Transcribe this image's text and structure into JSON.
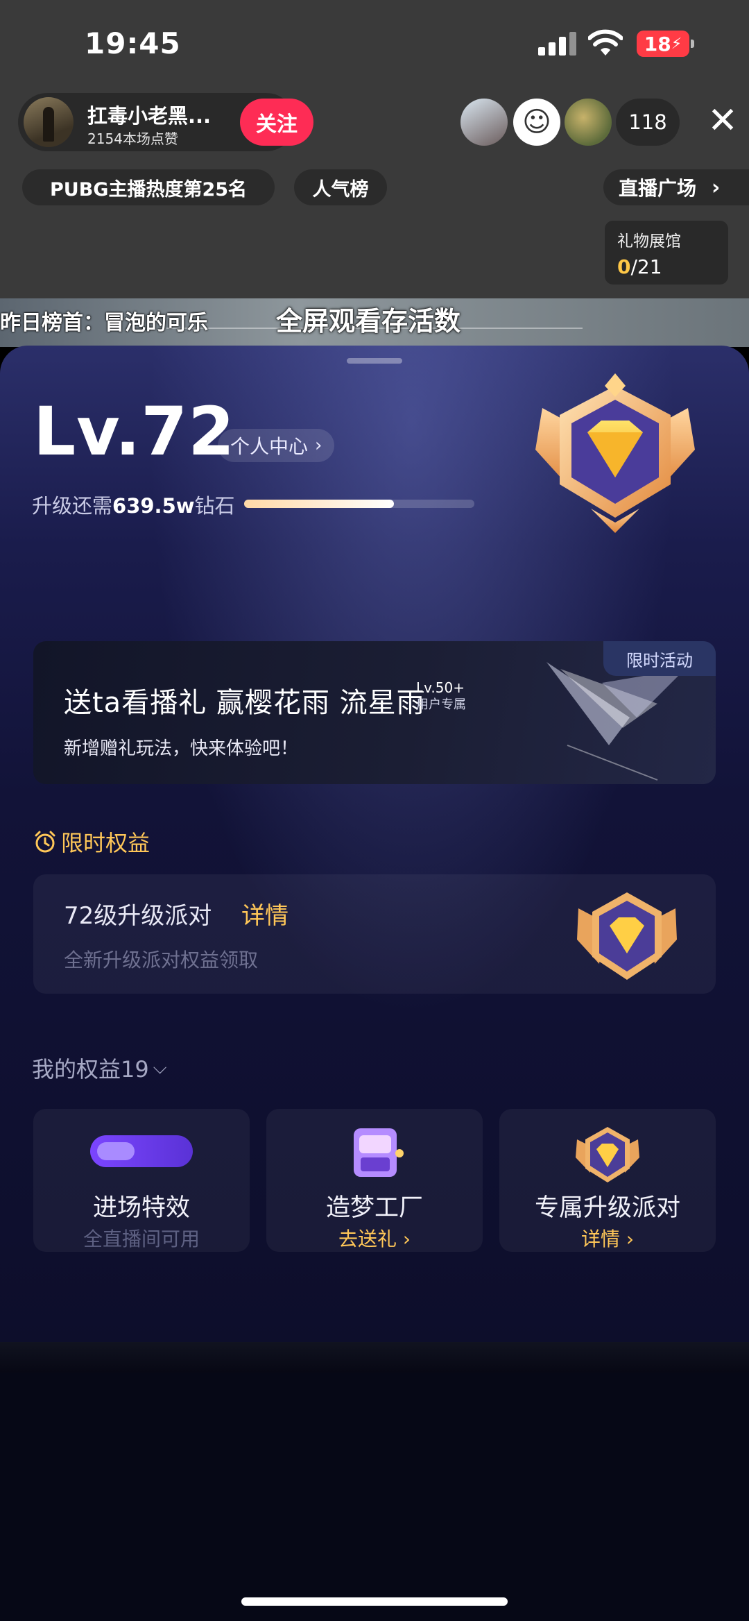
{
  "status_bar": {
    "time": "19:45",
    "battery": "18"
  },
  "anchor": {
    "name": "扛毒小老黑...",
    "likes": "2154本场点赞",
    "follow_label": "关注"
  },
  "viewers": {
    "count": "118"
  },
  "tags": {
    "rank": "PUBG主播热度第25名",
    "popular": "人气榜",
    "plaza": "直播广场"
  },
  "gift_hall": {
    "label": "礼物展馆",
    "current": "0",
    "total": "/21"
  },
  "video_overlay": {
    "yesterday_top": "昨日榜首：冒泡的可乐",
    "fullscreen_hint": "全屏观看存活数"
  },
  "level_panel": {
    "level": "Lv.72",
    "personal_center": "个人中心",
    "upgrade_prefix": "升级还需",
    "upgrade_amount": "639.5w",
    "upgrade_suffix": "钻石",
    "progress": 0.65
  },
  "banner": {
    "tag": "限时活动",
    "title": "送ta看播礼  赢樱花雨 流星雨",
    "lv_requirement": "Lv.50+",
    "lv_note": "用户专属",
    "subtitle": "新增赠礼玩法，快来体验吧！"
  },
  "limited_rights": {
    "title": "限时权益",
    "party_title": "72级升级派对",
    "party_detail": "详情",
    "party_desc": "全新升级派对权益领取"
  },
  "my_rights": {
    "label": "我的权益19",
    "items": [
      {
        "title": "进场特效",
        "sub": "全直播间可用"
      },
      {
        "title": "造梦工厂",
        "sub": "去送礼"
      },
      {
        "title": "专属升级派对",
        "sub": "详情"
      }
    ]
  },
  "colors": {
    "accent_gold": "#ffc758",
    "follow_red": "#fe2c55",
    "sheet_bg": "#121338"
  }
}
